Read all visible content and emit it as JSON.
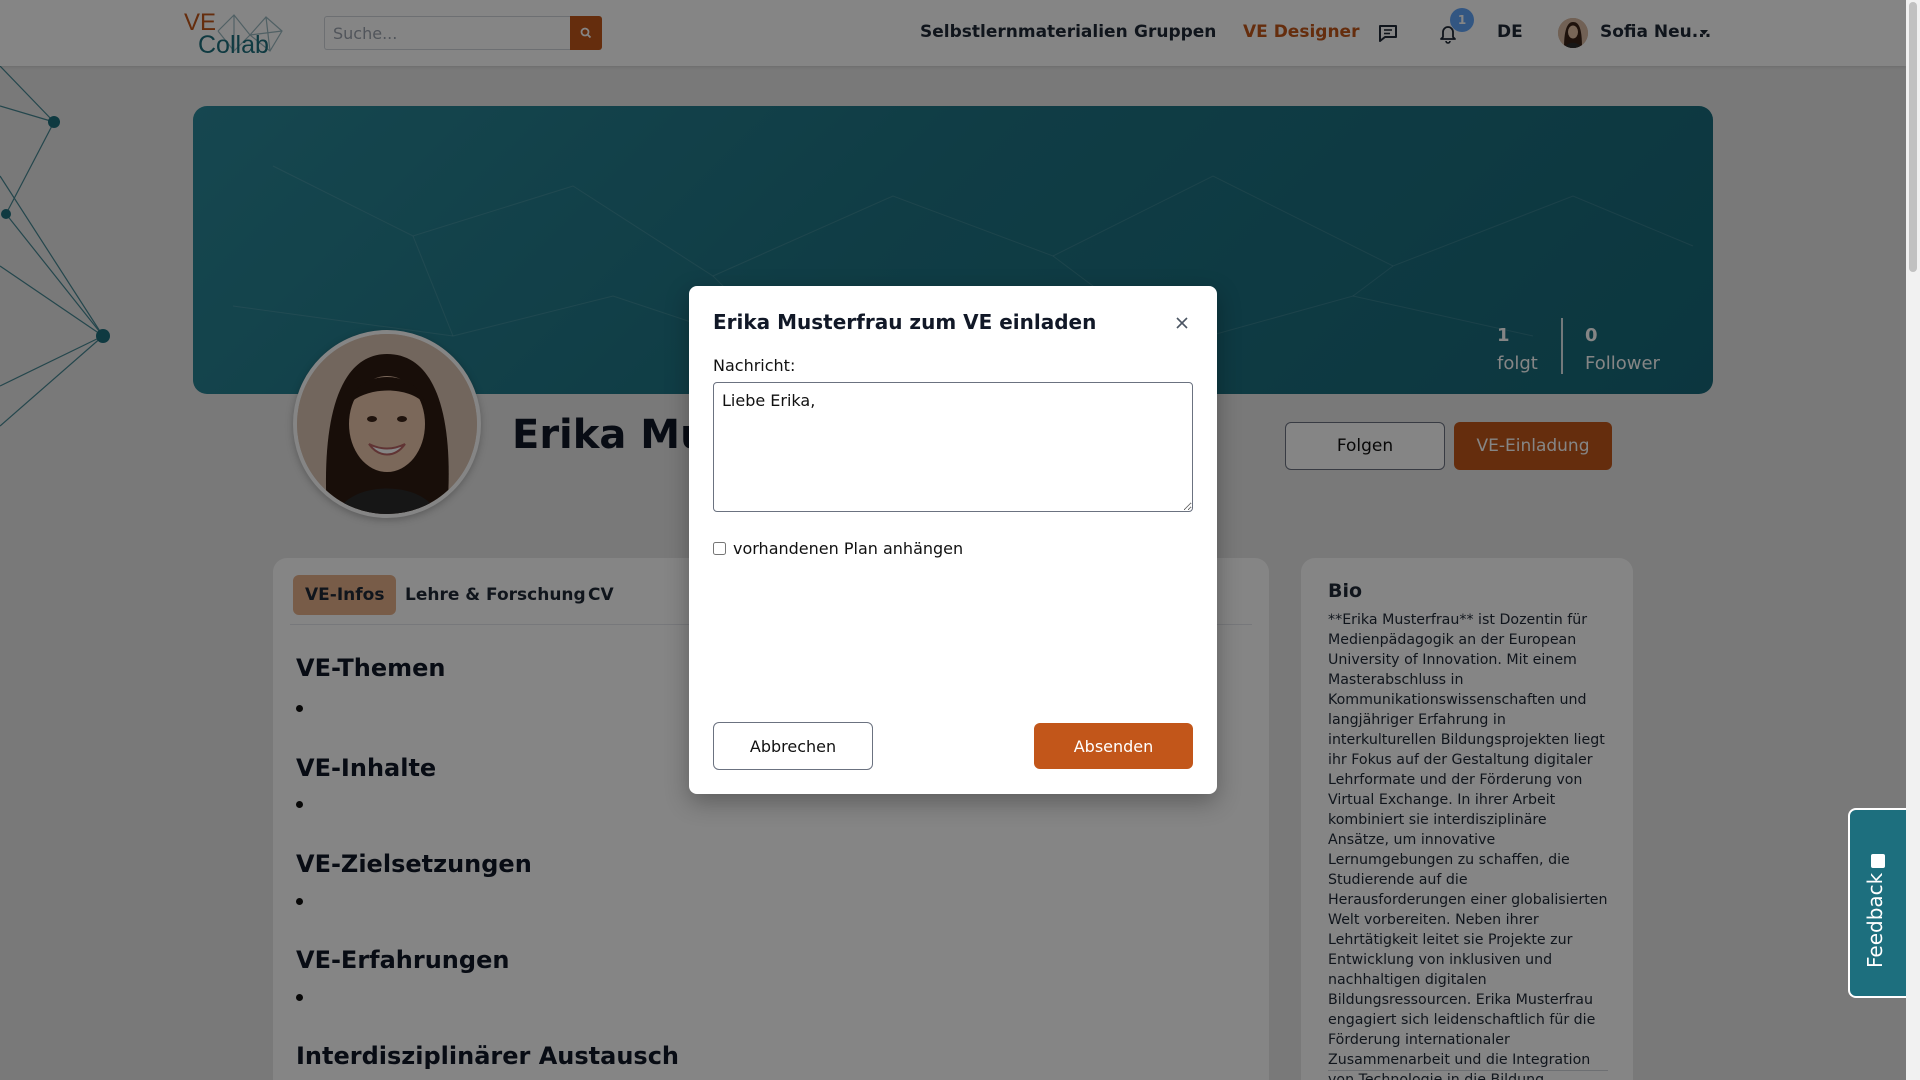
{
  "header": {
    "logo_ve": "VE",
    "logo_collab": "Collab",
    "search_placeholder": "Suche...",
    "nav": {
      "materials": "Selbstlernmaterialien",
      "groups": "Gruppen",
      "designer": "VE Designer"
    },
    "notification_count": "1",
    "language": "DE",
    "user_name": "Sofia Neu..."
  },
  "profile": {
    "name": "Erika Mus",
    "stats": {
      "following_count": "1",
      "following_label": "folgt",
      "followers_count": "0",
      "followers_label": "Follower"
    },
    "follow_button": "Folgen",
    "invite_button": "VE-Einladung"
  },
  "tabs": [
    "VE-Infos",
    "Lehre & Forschung",
    "CV"
  ],
  "sections": [
    "VE-Themen",
    "VE-Inhalte",
    "VE-Zielsetzungen",
    "VE-Erfahrungen",
    "Interdisziplinärer Austausch"
  ],
  "bio": {
    "title": "Bio",
    "text": "**Erika Musterfrau** ist Dozentin für Medienpädagogik an der European University of Innovation. Mit einem Masterabschluss in Kommunikationswissenschaften und langjähriger Erfahrung in interkulturellen Bildungsprojekten liegt ihr Fokus auf der Gestaltung digitaler Lehrformate und der Förderung von Virtual Exchange. In ihrer Arbeit kombiniert sie interdisziplinäre Ansätze, um innovative Lernumgebungen zu schaffen, die Studierende auf die Herausforderungen einer globalisierten Welt vorbereiten. Neben ihrer Lehrtätigkeit leitet sie Projekte zur Entwicklung von inklusiven und nachhaltigen digitalen Bildungsressourcen. Erika Musterfrau engagiert sich leidenschaftlich für die Förderung internationaler Zusammenarbeit und die Integration von Technologie in die Bildung."
  },
  "modal": {
    "title": "Erika Musterfrau zum VE einladen",
    "message_label": "Nachricht:",
    "message_value": "Liebe Erika,",
    "attach_plan_label": "vorhandenen Plan anhängen",
    "attach_plan_checked": false,
    "cancel_button": "Abbrechen",
    "submit_button": "Absenden"
  },
  "feedback_label": "Feedback",
  "colors": {
    "accent": "#c2561a",
    "brand_teal": "#1d6f7e",
    "badge": "#60a5fa"
  }
}
